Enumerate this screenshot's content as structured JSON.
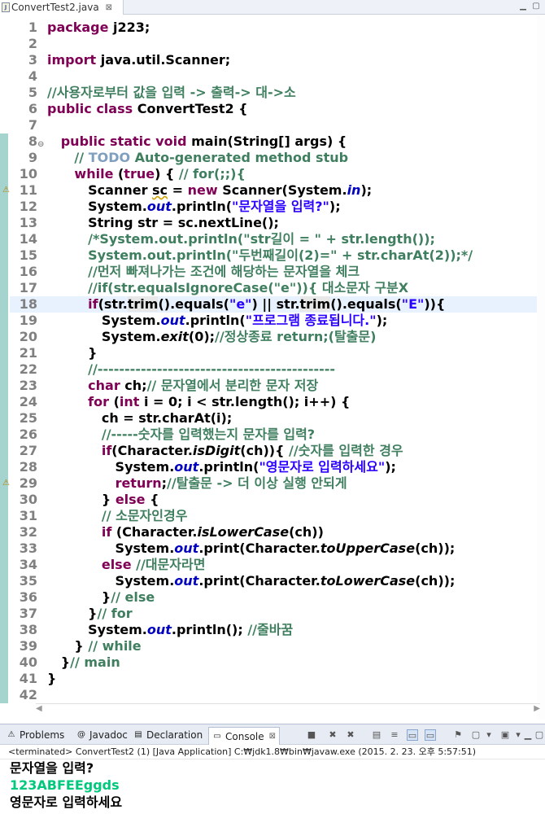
{
  "editor": {
    "tab_title": "ConvertTest2.java",
    "tab_close": "⊠"
  },
  "code_lines": [
    [
      [
        "kw",
        "package "
      ],
      [
        "vr",
        "j223;"
      ]
    ],
    [],
    [
      [
        "kw",
        "import "
      ],
      [
        "vr",
        "java.util.Scanner;"
      ]
    ],
    [],
    [
      [
        "cm",
        "//사용자로부터 값을 입력 -> 출력-> 대->소"
      ]
    ],
    [
      [
        "kw",
        "public class "
      ],
      [
        "vr",
        "ConvertTest2 {"
      ]
    ],
    [],
    [
      [
        "vr",
        "   "
      ],
      [
        "kw",
        "public static void "
      ],
      [
        "vr",
        "main(String[] args) {"
      ]
    ],
    [
      [
        "vr",
        "      "
      ],
      [
        "cm",
        "// "
      ],
      [
        "todo",
        "TODO"
      ],
      [
        "cm",
        " Auto-generated method stub"
      ]
    ],
    [
      [
        "vr",
        "      "
      ],
      [
        "kw",
        "while "
      ],
      [
        "vr",
        "("
      ],
      [
        "kw",
        "true"
      ],
      [
        "vr",
        ") { "
      ],
      [
        "cm",
        "// for(;;){"
      ]
    ],
    [
      [
        "vr",
        "         Scanner "
      ],
      [
        "err",
        "sc"
      ],
      [
        "vr",
        " = "
      ],
      [
        "kw",
        "new "
      ],
      [
        "vr",
        "Scanner(System."
      ],
      [
        "fd",
        "in"
      ],
      [
        "vr",
        ");"
      ]
    ],
    [
      [
        "vr",
        "         System."
      ],
      [
        "fd",
        "out"
      ],
      [
        "vr",
        ".println("
      ],
      [
        "st",
        "\"문자열을 입력?\""
      ],
      [
        "vr",
        ");"
      ]
    ],
    [
      [
        "vr",
        "         String str = sc.nextLine();"
      ]
    ],
    [
      [
        "vr",
        "         "
      ],
      [
        "cm",
        "/*System.out.println(\"str길이 = \" + str.length());"
      ]
    ],
    [
      [
        "vr",
        "         "
      ],
      [
        "cm",
        "System.out.println(\"두번째길이(2)=\" + str.charAt(2));*/"
      ]
    ],
    [
      [
        "vr",
        "         "
      ],
      [
        "cm",
        "//먼저 빠져나가는 조건에 해당하는 문자열을 체크"
      ]
    ],
    [
      [
        "vr",
        "         "
      ],
      [
        "cm",
        "//if(str.equalsIgnoreCase(\"e\")){ 대소문자 구분X"
      ]
    ],
    [
      [
        "vr",
        "         "
      ],
      [
        "kw",
        "if"
      ],
      [
        "vr",
        "(str."
      ],
      [
        "hl",
        "trim"
      ],
      [
        "vr",
        "().equals("
      ],
      [
        "st",
        "\"e\""
      ],
      [
        "vr",
        ") || str."
      ],
      [
        "hl",
        "trim"
      ],
      [
        "vr",
        "().equals("
      ],
      [
        "st",
        "\"E\""
      ],
      [
        "vr",
        "))"
      ],
      [
        "vr",
        "{"
      ]
    ],
    [
      [
        "vr",
        "            System."
      ],
      [
        "fd",
        "out"
      ],
      [
        "vr",
        ".println("
      ],
      [
        "st",
        "\"프로그램 종료됩니다.\""
      ],
      [
        "vr",
        ");"
      ]
    ],
    [
      [
        "vr",
        "            System."
      ],
      [
        "sm",
        "exit"
      ],
      [
        "vr",
        "(0);"
      ],
      [
        "cm",
        "//정상종료 return;(탈출문)"
      ]
    ],
    [
      [
        "vr",
        "         }"
      ]
    ],
    [
      [
        "vr",
        "         "
      ],
      [
        "cm",
        "//--------------------------------------------"
      ]
    ],
    [
      [
        "vr",
        "         "
      ],
      [
        "kw",
        "char "
      ],
      [
        "vr",
        "ch;"
      ],
      [
        "cm",
        "// 문자열에서 분리한 문자 저장"
      ]
    ],
    [
      [
        "vr",
        "         "
      ],
      [
        "kw",
        "for "
      ],
      [
        "vr",
        "("
      ],
      [
        "kw",
        "int "
      ],
      [
        "vr",
        "i = 0; i < str.length(); i++) {"
      ]
    ],
    [
      [
        "vr",
        "            ch = str.charAt(i);"
      ]
    ],
    [
      [
        "vr",
        "            "
      ],
      [
        "cm",
        "//-----숫자를 입력했는지 문자를 입력?"
      ]
    ],
    [
      [
        "vr",
        "            "
      ],
      [
        "kw",
        "if"
      ],
      [
        "vr",
        "(Character."
      ],
      [
        "sm",
        "isDigit"
      ],
      [
        "vr",
        "(ch)){ "
      ],
      [
        "cm",
        "//숫자를 입력한 경우"
      ]
    ],
    [
      [
        "vr",
        "               System."
      ],
      [
        "fd",
        "out"
      ],
      [
        "vr",
        ".println("
      ],
      [
        "st",
        "\"영문자로 입력하세요\""
      ],
      [
        "vr",
        ");"
      ]
    ],
    [
      [
        "vr",
        "               "
      ],
      [
        "kw",
        "return"
      ],
      [
        "vr",
        ";"
      ],
      [
        "cm",
        "//탈출문 -> 더 이상 실행 안되게"
      ]
    ],
    [
      [
        "vr",
        "            } "
      ],
      [
        "kw",
        "else "
      ],
      [
        "vr",
        "{"
      ]
    ],
    [
      [
        "vr",
        "            "
      ],
      [
        "cm",
        "// 소문자인경우"
      ]
    ],
    [
      [
        "vr",
        "            "
      ],
      [
        "kw",
        "if "
      ],
      [
        "vr",
        "(Character."
      ],
      [
        "sm",
        "isLowerCase"
      ],
      [
        "vr",
        "(ch))"
      ]
    ],
    [
      [
        "vr",
        "               System."
      ],
      [
        "fd",
        "out"
      ],
      [
        "vr",
        ".print(Character."
      ],
      [
        "sm",
        "toUpperCase"
      ],
      [
        "vr",
        "(ch));"
      ]
    ],
    [
      [
        "vr",
        "            "
      ],
      [
        "kw",
        "else "
      ],
      [
        "cm",
        "//대문자라면"
      ]
    ],
    [
      [
        "vr",
        "               System."
      ],
      [
        "fd",
        "out"
      ],
      [
        "vr",
        ".print(Character."
      ],
      [
        "sm",
        "toLowerCase"
      ],
      [
        "vr",
        "(ch));"
      ]
    ],
    [
      [
        "vr",
        "            }"
      ],
      [
        "cm",
        "// else"
      ]
    ],
    [
      [
        "vr",
        "         }"
      ],
      [
        "cm",
        "// for"
      ]
    ],
    [
      [
        "vr",
        "         System."
      ],
      [
        "fd",
        "out"
      ],
      [
        "vr",
        ".println(); "
      ],
      [
        "cm",
        "//줄바꿈"
      ]
    ],
    [
      [
        "vr",
        "      } "
      ],
      [
        "cm",
        "// while"
      ]
    ],
    [
      [
        "vr",
        "   }"
      ],
      [
        "cm",
        "// main"
      ]
    ],
    [
      [
        "vr",
        "}"
      ]
    ],
    []
  ],
  "current_line": 18,
  "fold_lines": [
    8
  ],
  "warning_lines": [
    11,
    29
  ],
  "console_tabs": [
    {
      "label": "Problems",
      "icon": "problems-icon",
      "glyph": "⚠"
    },
    {
      "label": "Javadoc",
      "icon": "at-icon",
      "glyph": "@"
    },
    {
      "label": "Declaration",
      "icon": "declaration-icon",
      "glyph": "▤"
    },
    {
      "label": "Console",
      "icon": "console-icon",
      "glyph": "▭",
      "active": true
    }
  ],
  "console": {
    "status": "<terminated> ConvertTest2 (1) [Java Application] C:₩jdk1.8₩bin₩javaw.exe (2015. 2. 23. 오후 5:57:51)",
    "lines": [
      {
        "text": "문자열을 입력?",
        "kind": "out"
      },
      {
        "text": "123ABFEEggds",
        "kind": "in"
      },
      {
        "text": "영문자로 입력하세요",
        "kind": "out"
      }
    ]
  },
  "colors": {
    "keyword": "#7f0055",
    "comment": "#3f7f5f",
    "string": "#2a00ff",
    "field": "#0000c0",
    "console_input": "#00c87d"
  }
}
